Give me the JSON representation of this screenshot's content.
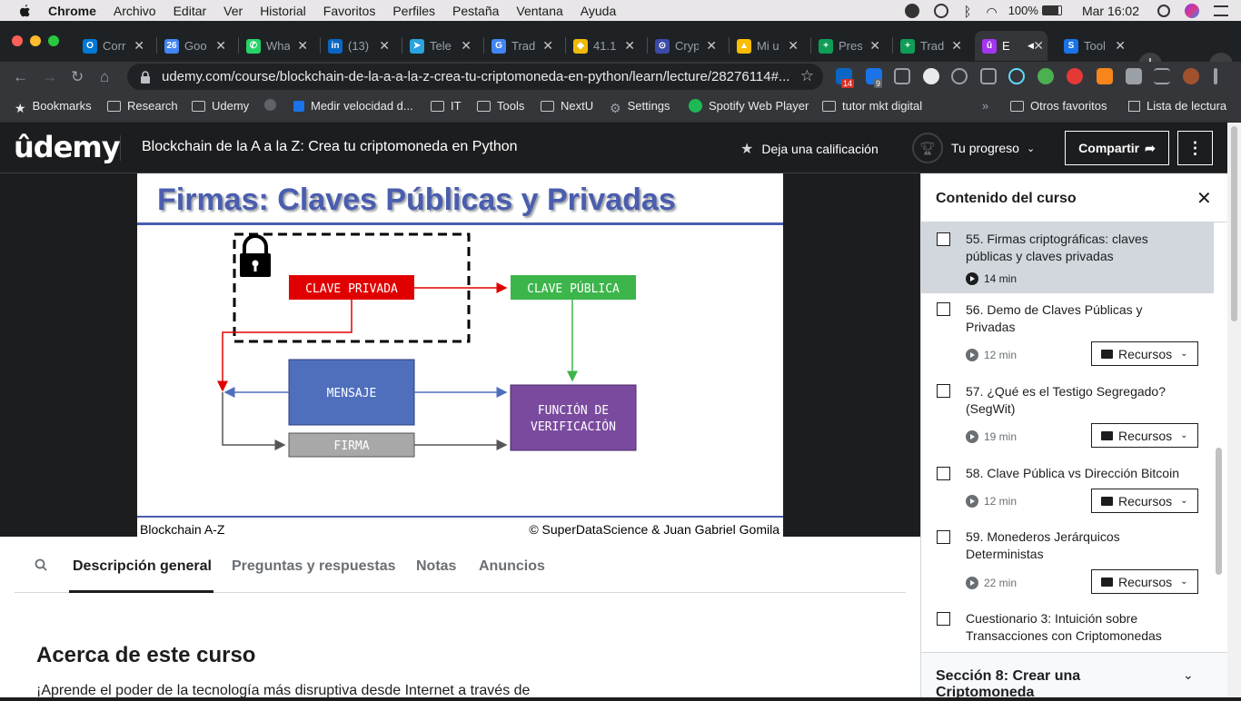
{
  "menubar": {
    "app": "Chrome",
    "items": [
      "Archivo",
      "Editar",
      "Ver",
      "Historial",
      "Favoritos",
      "Perfiles",
      "Pestaña",
      "Ventana",
      "Ayuda"
    ],
    "battery": "100%",
    "clock": "Mar 16:02"
  },
  "tabs": [
    {
      "title": "Corr",
      "fav_color": "#0078d4",
      "fav_glyph": "O"
    },
    {
      "title": "Goo",
      "fav_color": "#4285f4",
      "fav_glyph": "26"
    },
    {
      "title": "Wha",
      "fav_color": "#25d366",
      "fav_glyph": "✆"
    },
    {
      "title": "(13)",
      "fav_color": "#0a66c2",
      "fav_glyph": "in"
    },
    {
      "title": "Tele",
      "fav_color": "#2aa3de",
      "fav_glyph": "➤"
    },
    {
      "title": "Trad",
      "fav_color": "#4285f4",
      "fav_glyph": "G"
    },
    {
      "title": "41.1(",
      "fav_color": "#f0b90b",
      "fav_glyph": "◆"
    },
    {
      "title": "Cryp",
      "fav_color": "#3b4ba8",
      "fav_glyph": "⊙"
    },
    {
      "title": "Mi u",
      "fav_color": "#fbbc04",
      "fav_glyph": "▲"
    },
    {
      "title": "Pres",
      "fav_color": "#0f9d58",
      "fav_glyph": "+"
    },
    {
      "title": "Trad",
      "fav_color": "#0f9d58",
      "fav_glyph": "+"
    },
    {
      "title": "E",
      "fav_color": "#a435f0",
      "fav_glyph": "û"
    },
    {
      "title": "Tool",
      "fav_color": "#1a73e8",
      "fav_glyph": "S"
    }
  ],
  "address": {
    "url": "udemy.com/course/blockchain-de-la-a-a-la-z-crea-tu-criptomoneda-en-python/learn/lecture/28276114#..."
  },
  "extensions": {
    "linkedin_badge": "14",
    "mk_badge": "9"
  },
  "bookmarks": {
    "items": [
      "Bookmarks",
      "Research",
      "Udemy",
      "Medir velocidad d...",
      "IT",
      "Tools",
      "NextU",
      "Settings",
      "Spotify Web Player",
      "tutor mkt digital"
    ],
    "overflow": "»",
    "other": "Otros favoritos",
    "reading": "Lista de lectura"
  },
  "header": {
    "logo": "ûdemy",
    "course_title": "Blockchain de la A a la Z: Crea tu criptomoneda en Python",
    "rate": "Deja una calificación",
    "progress": "Tu progreso",
    "share": "Compartir",
    "more": "⋮"
  },
  "slide": {
    "title": "Firmas: Claves Públicas y Privadas",
    "private_key": "CLAVE PRIVADA",
    "public_key": "CLAVE PÚBLICA",
    "message": "MENSAJE",
    "signature": "FIRMA",
    "verify_1": "FUNCIÓN DE",
    "verify_2": "VERIFICACIÓN",
    "footer_left": "Blockchain A-Z",
    "footer_right": "© SuperDataScience & Juan Gabriel Gomila",
    "colors": {
      "private": "#e00000",
      "public": "#3cb54a",
      "message": "#4f6fbd",
      "signature": "#a8a8a8",
      "verify": "#7a4a9e"
    }
  },
  "lower": {
    "tabs": [
      "Descripción general",
      "Preguntas y respuestas",
      "Notas",
      "Anuncios"
    ],
    "about_title": "Acerca de este curso",
    "about_desc": "¡Aprende el poder de la tecnología más disruptiva desde Internet a través de"
  },
  "sidebar": {
    "title": "Contenido del curso",
    "resources_label": "Recursos",
    "lessons": [
      {
        "title": "55. Firmas criptográficas: claves públicas y claves privadas",
        "duration": "14 min",
        "selected": true
      },
      {
        "title": "56. Demo de Claves Públicas y Privadas",
        "duration": "12 min"
      },
      {
        "title": "57. ¿Qué es el Testigo Segregado? (SegWit)",
        "duration": "19 min"
      },
      {
        "title": "58. Clave Pública vs Dirección Bitcoin",
        "duration": "12 min"
      },
      {
        "title": "59. Monederos Jerárquicos Deterministas",
        "duration": "22 min"
      },
      {
        "title": "Cuestionario 3: Intuición sobre Transacciones con Criptomonedas"
      }
    ],
    "section": "Sección 8: Crear una Criptomoneda"
  }
}
